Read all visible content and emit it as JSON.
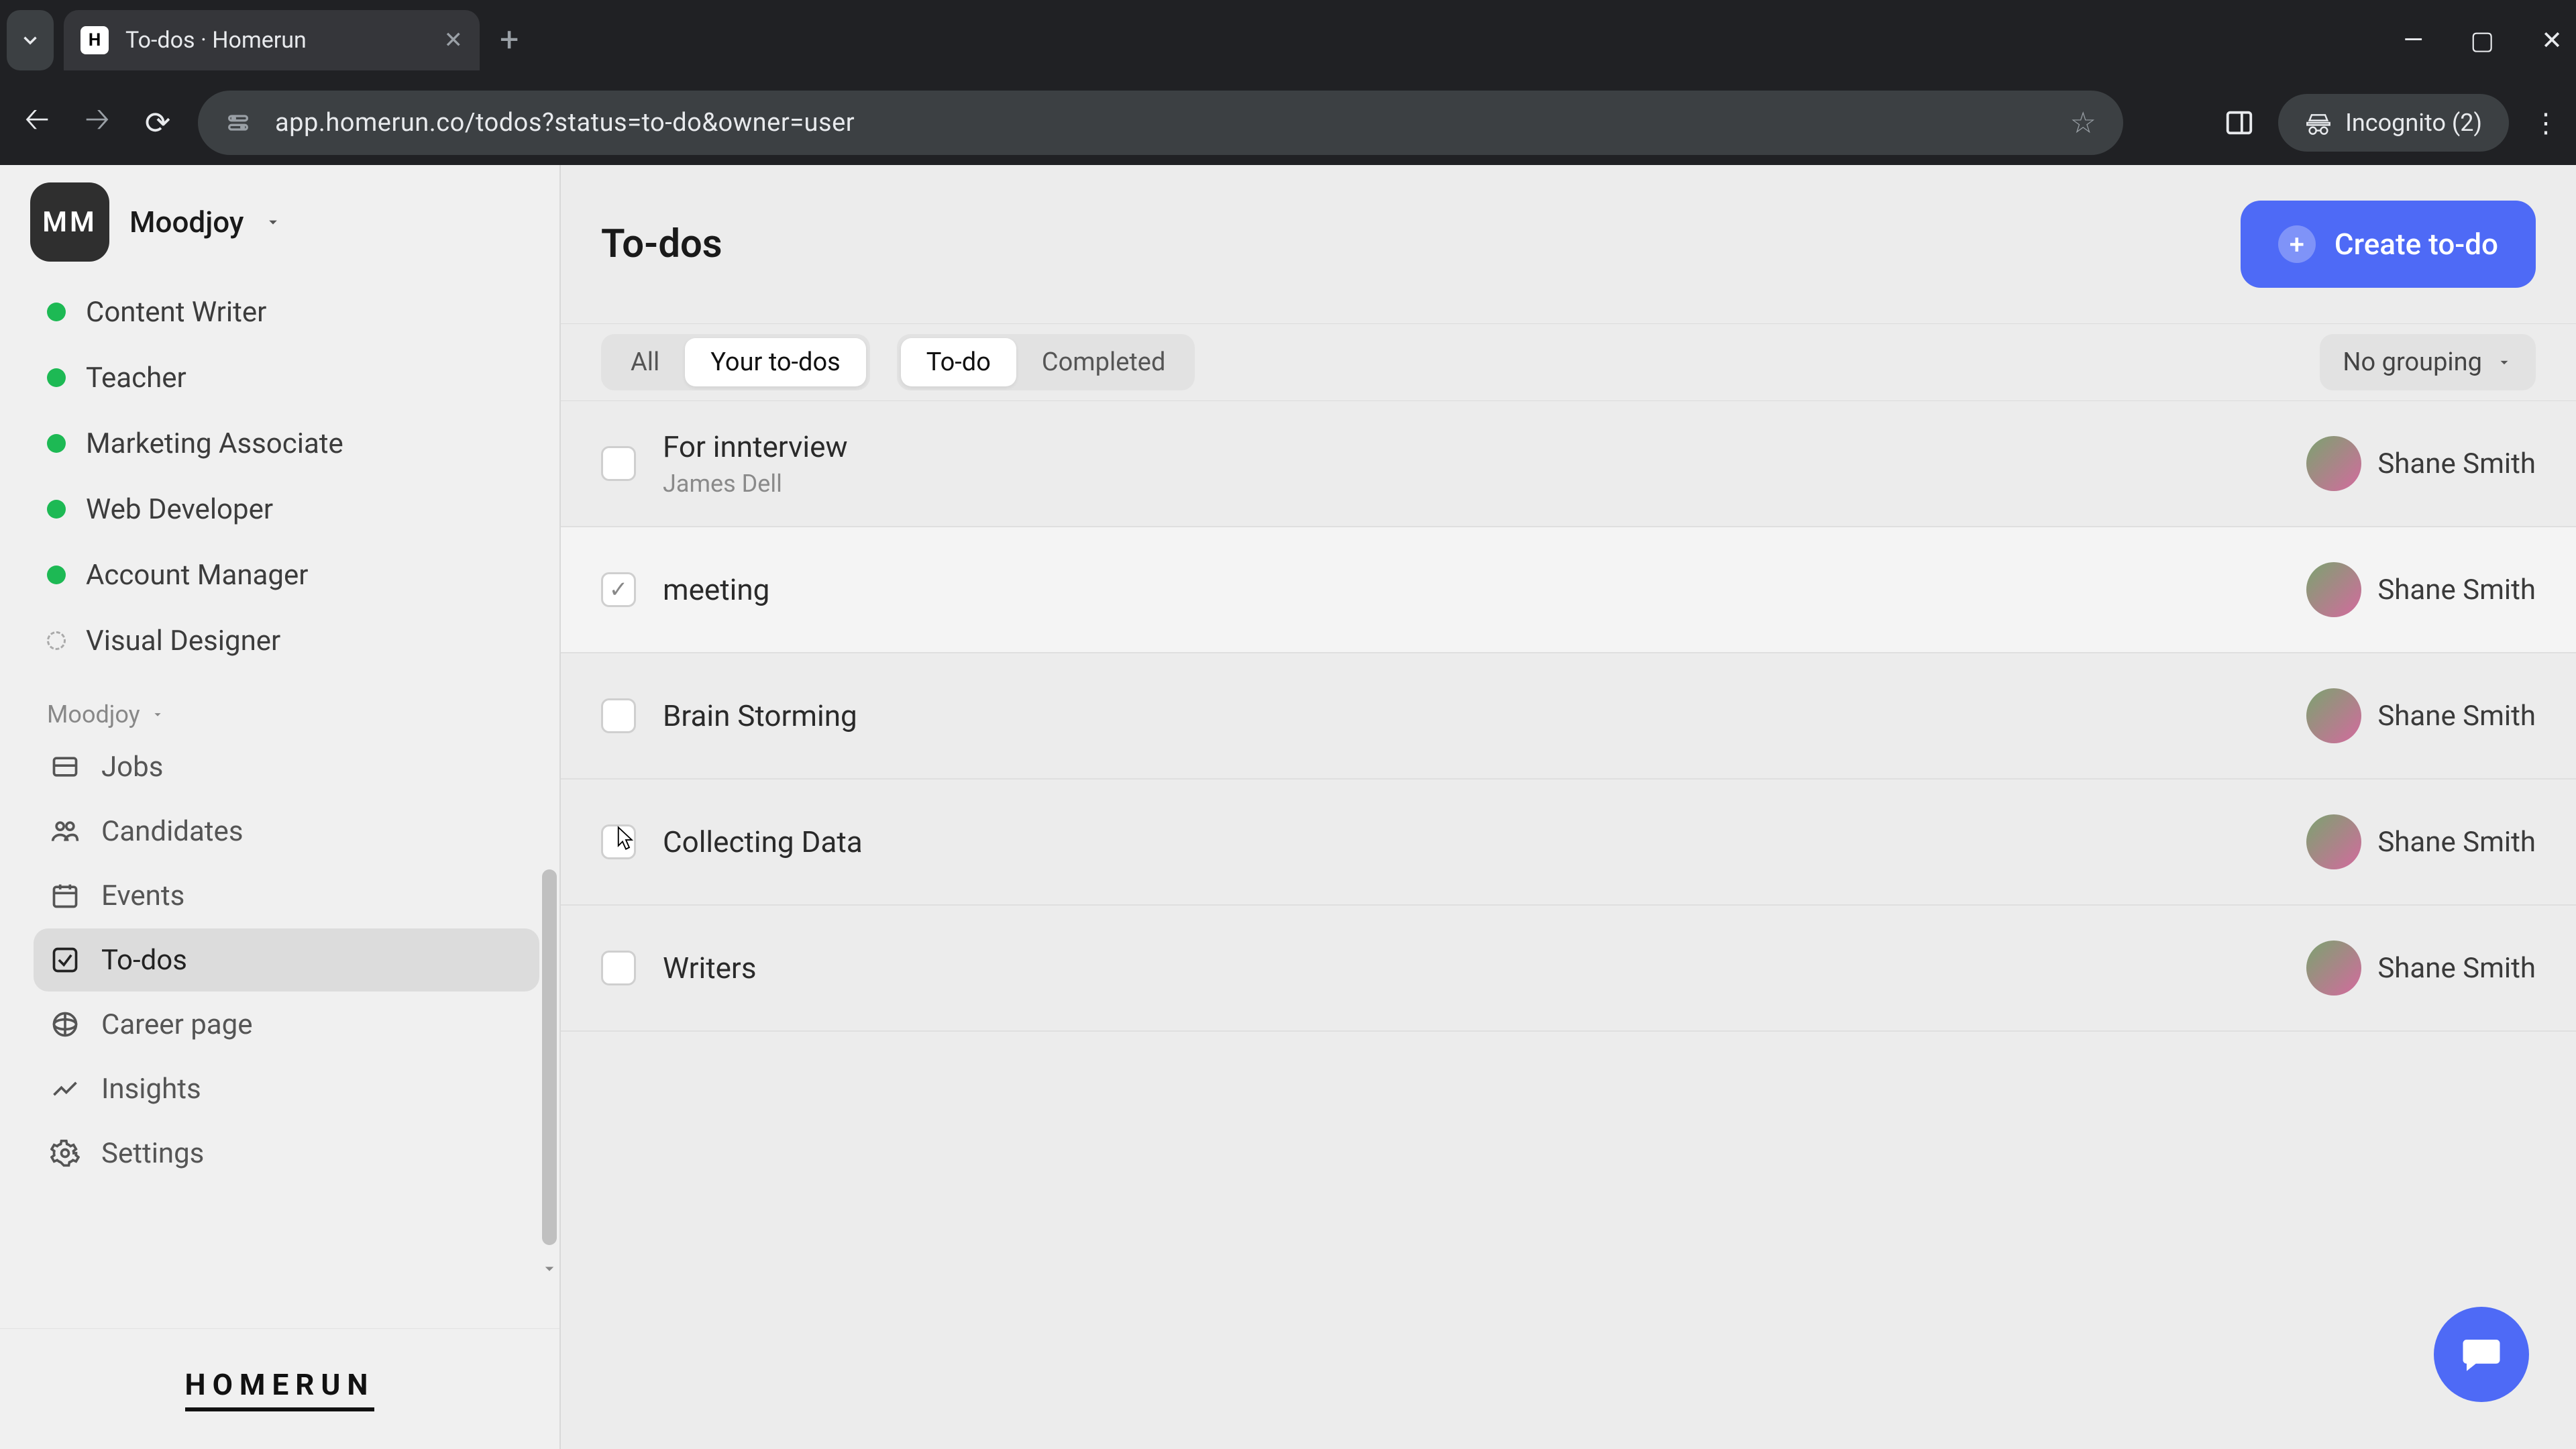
{
  "browser": {
    "tab_title": "To-dos · Homerun",
    "favicon_letter": "H",
    "url": "app.homerun.co/todos?status=to-do&owner=user",
    "incognito_label": "Incognito (2)"
  },
  "workspace": {
    "initials": "MM",
    "name": "Moodjoy"
  },
  "sidebar": {
    "jobs": [
      {
        "label": "Content Writer",
        "status": "active"
      },
      {
        "label": "Teacher",
        "status": "active"
      },
      {
        "label": "Marketing Associate",
        "status": "active"
      },
      {
        "label": "Web Developer",
        "status": "active"
      },
      {
        "label": "Account Manager",
        "status": "active"
      },
      {
        "label": "Visual Designer",
        "status": "draft"
      }
    ],
    "section_label": "Moodjoy",
    "nav": [
      {
        "key": "jobs",
        "label": "Jobs"
      },
      {
        "key": "candidates",
        "label": "Candidates"
      },
      {
        "key": "events",
        "label": "Events"
      },
      {
        "key": "todos",
        "label": "To-dos"
      },
      {
        "key": "career",
        "label": "Career page"
      },
      {
        "key": "insights",
        "label": "Insights"
      },
      {
        "key": "settings",
        "label": "Settings"
      }
    ],
    "active_nav": "todos",
    "brand": "HOMERUN"
  },
  "header": {
    "title": "To-dos",
    "create_label": "Create to-do"
  },
  "filters": {
    "owner": {
      "options": [
        "All",
        "Your to-dos"
      ],
      "active": "Your to-dos"
    },
    "status": {
      "options": [
        "To-do",
        "Completed"
      ],
      "active": "To-do"
    },
    "grouping_label": "No grouping"
  },
  "todos": [
    {
      "title": "For innterview",
      "subtitle": "James Dell",
      "assignee": "Shane Smith",
      "hovered": false,
      "checking": false
    },
    {
      "title": "meeting",
      "subtitle": "",
      "assignee": "Shane Smith",
      "hovered": true,
      "checking": true
    },
    {
      "title": "Brain Storming",
      "subtitle": "",
      "assignee": "Shane Smith",
      "hovered": false,
      "checking": false
    },
    {
      "title": "Collecting Data",
      "subtitle": "",
      "assignee": "Shane Smith",
      "hovered": false,
      "checking": false
    },
    {
      "title": "Writers",
      "subtitle": "",
      "assignee": "Shane Smith",
      "hovered": false,
      "checking": false
    }
  ]
}
